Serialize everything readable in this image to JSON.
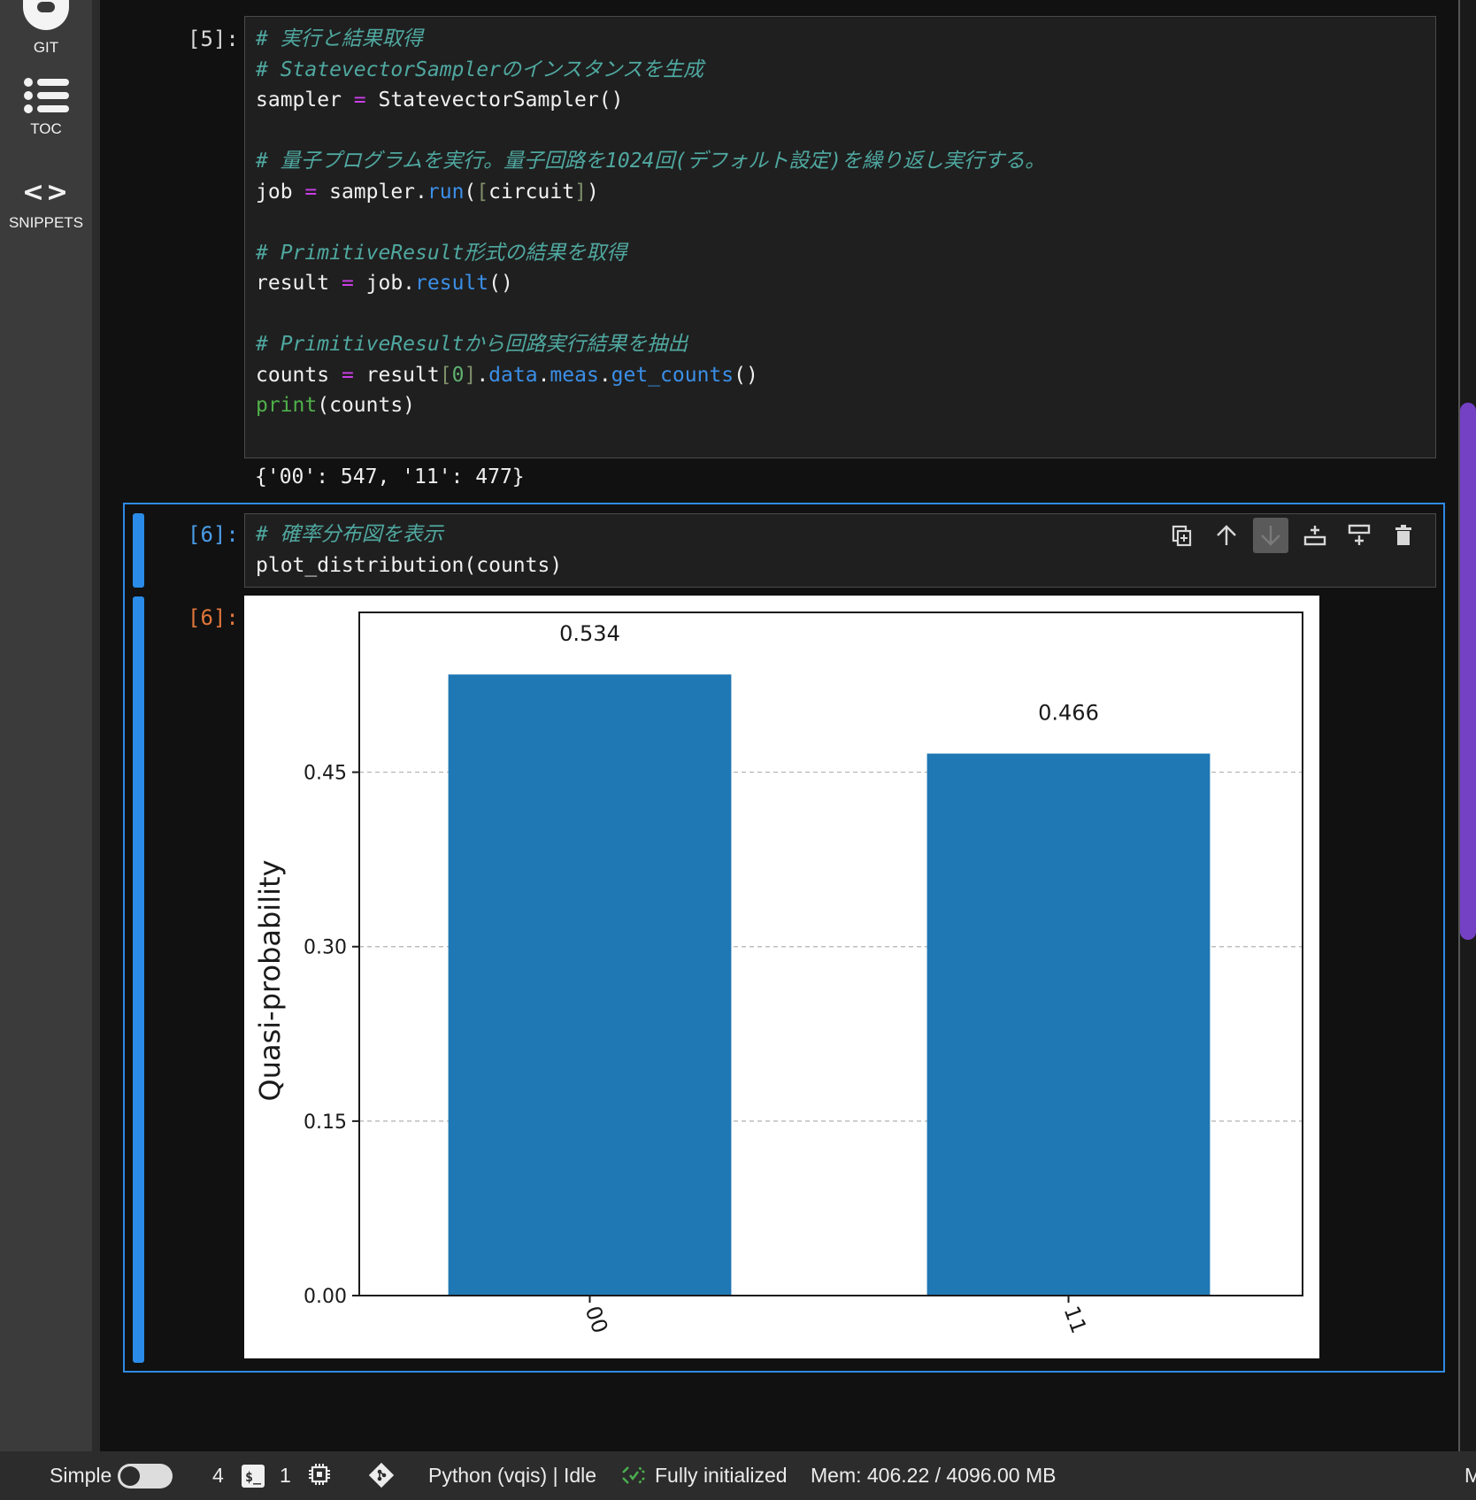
{
  "sidebar": {
    "items": [
      {
        "label": "GIT",
        "icon": "git-icon"
      },
      {
        "label": "TOC",
        "icon": "list-icon"
      },
      {
        "label": "SNIPPETS",
        "icon": "code-brackets-icon"
      }
    ]
  },
  "cells": [
    {
      "prompt": "[5]:",
      "code_lines": [
        [
          {
            "t": "# 実行と結果取得",
            "c": "cm"
          }
        ],
        [
          {
            "t": "# StatevectorSamplerのインスタンスを生成",
            "c": "cm"
          }
        ],
        [
          {
            "t": "sampler "
          },
          {
            "t": "=",
            "c": "op"
          },
          {
            "t": " StatevectorSampler()"
          }
        ],
        [
          {
            "t": ""
          }
        ],
        [
          {
            "t": "# 量子プログラムを実行。量子回路を1024回(デフォルト設定)を繰り返し実行する。",
            "c": "cm"
          }
        ],
        [
          {
            "t": "job "
          },
          {
            "t": "=",
            "c": "op"
          },
          {
            "t": " sampler."
          },
          {
            "t": "run",
            "c": "fn"
          },
          {
            "t": "("
          },
          {
            "t": "[",
            "c": "br"
          },
          {
            "t": "circuit"
          },
          {
            "t": "]",
            "c": "br"
          },
          {
            "t": ")"
          }
        ],
        [
          {
            "t": ""
          }
        ],
        [
          {
            "t": "# PrimitiveResult形式の結果を取得",
            "c": "cm"
          }
        ],
        [
          {
            "t": "result "
          },
          {
            "t": "=",
            "c": "op"
          },
          {
            "t": " job."
          },
          {
            "t": "result",
            "c": "fn"
          },
          {
            "t": "()"
          }
        ],
        [
          {
            "t": ""
          }
        ],
        [
          {
            "t": "# PrimitiveResultから回路実行結果を抽出",
            "c": "cm"
          }
        ],
        [
          {
            "t": "counts "
          },
          {
            "t": "=",
            "c": "op"
          },
          {
            "t": " result"
          },
          {
            "t": "[",
            "c": "br"
          },
          {
            "t": "0",
            "c": "nm"
          },
          {
            "t": "]",
            "c": "br"
          },
          {
            "t": "."
          },
          {
            "t": "data",
            "c": "fn"
          },
          {
            "t": "."
          },
          {
            "t": "meas",
            "c": "fn"
          },
          {
            "t": "."
          },
          {
            "t": "get_counts",
            "c": "fn"
          },
          {
            "t": "()"
          }
        ],
        [
          {
            "t": "print",
            "c": "bi"
          },
          {
            "t": "(counts)"
          }
        ]
      ],
      "output": "{'00': 547, '11': 477}"
    },
    {
      "prompt": "[6]:",
      "code_lines": [
        [
          {
            "t": "# 確率分布図を表示",
            "c": "cm"
          }
        ],
        [
          {
            "t": "plot_distribution(counts)"
          }
        ]
      ],
      "output_prompt": "[6]:"
    }
  ],
  "toolbar": {
    "buttons": [
      {
        "icon": "duplicate-icon",
        "name": "duplicate-cell-button"
      },
      {
        "icon": "arrow-up-icon",
        "name": "move-up-button"
      },
      {
        "icon": "arrow-down-icon",
        "name": "move-down-button",
        "active": true
      },
      {
        "icon": "insert-above-icon",
        "name": "insert-above-button"
      },
      {
        "icon": "insert-below-icon",
        "name": "insert-below-button"
      },
      {
        "icon": "trash-icon",
        "name": "delete-cell-button"
      }
    ]
  },
  "chart_data": {
    "type": "bar",
    "categories": [
      "00",
      "11"
    ],
    "values": [
      0.534,
      0.466
    ],
    "value_labels": [
      "0.534",
      "0.466"
    ],
    "ylabel": "Quasi-probability",
    "xlabel": "",
    "yticks": [
      0.0,
      0.15,
      0.3,
      0.45
    ],
    "ytick_labels": [
      "0.00",
      "0.15",
      "0.30",
      "0.45"
    ],
    "ylim": [
      0,
      0.5874
    ],
    "bar_color": "#1f77b4",
    "grid": "horizontal-dashed"
  },
  "statusbar": {
    "mode": "Simple",
    "terminals": "4",
    "terminal_icon": "$_",
    "kernels": "1",
    "kernel_status": "Python (vqis) | Idle",
    "init_status": "Fully initialized",
    "memory": "Mem: 406.22 / 4096.00 MB",
    "right_clip": "M"
  },
  "colors": {
    "accent": "#2f8ae5",
    "scroll_thumb": "#7440c4",
    "comment": "#4fa8a0",
    "operator": "#cc3ee8",
    "method": "#3b8fe8"
  }
}
